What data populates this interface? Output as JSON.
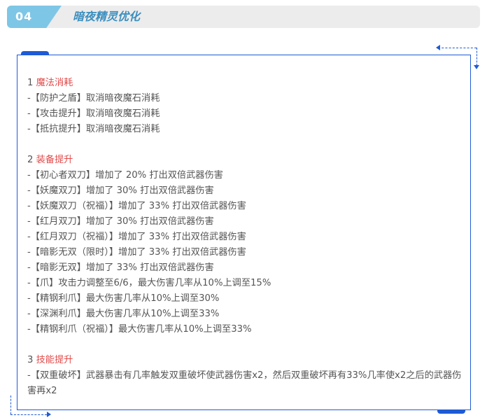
{
  "header": {
    "number": "04",
    "title": "暗夜精灵优化"
  },
  "sections": [
    {
      "num": "1",
      "title": "魔法消耗",
      "lines": [
        "-【防护之盾】取消暗夜魔石消耗",
        "-【攻击提升】取消暗夜魔石消耗",
        "-【抵抗提升】取消暗夜魔石消耗"
      ]
    },
    {
      "num": "2",
      "title": "装备提升",
      "lines": [
        "-【初心者双刀】增加了 20% 打出双倍武器伤害",
        "-【妖魔双刀】增加了 30% 打出双倍武器伤害",
        "-【妖魔双刀（祝福）】增加了 33% 打出双倍武器伤害",
        "-【红月双刀】增加了 30% 打出双倍武器伤害",
        "-【红月双刀（祝福）】增加了 33% 打出双倍武器伤害",
        "-【暗影无双（限时）】增加了 33% 打出双倍武器伤害",
        "-【暗影无双】增加了 33% 打出双倍武器伤害",
        "-【爪】攻击力调整至6/6，最大伤害几率从10%上调至15%",
        "-【精钢利爪】最大伤害几率从10%上调至30%",
        "-【深渊利爪】最大伤害几率从10%上调至33%",
        "-【精钢利爪（祝福）】最大伤害几率从10%上调至33%"
      ]
    },
    {
      "num": "3",
      "title": "技能提升",
      "lines": [
        "-【双重破坏】武器暴击有几率触发双重破坏使武器伤害x2，然后双重破坏再有33%几率使x2之后的武器伤害再x2"
      ]
    }
  ],
  "colors": {
    "accent_blue": "#1e5bd6",
    "section_title_red": "#e24b4b",
    "header_tab": "#7ec6e6",
    "header_title": "#3c8fbf"
  }
}
